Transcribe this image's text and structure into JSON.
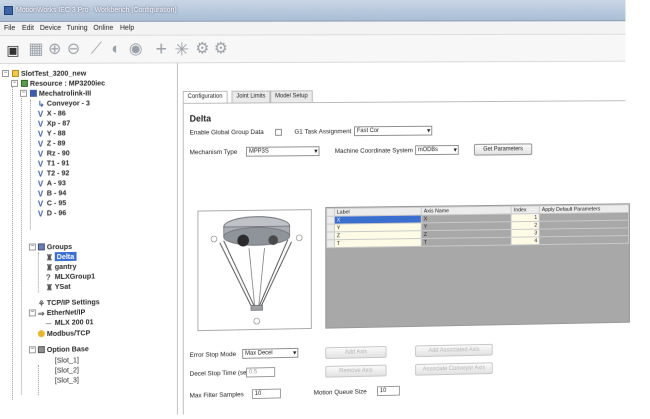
{
  "window": {
    "title": "MotionWorks IEC 3 Pro - Workbench (Configuration)"
  },
  "menu": [
    "File",
    "Edit",
    "Device",
    "Tuning",
    "Online",
    "Help"
  ],
  "toolbar": [
    "save-icon",
    "grid-icon",
    "zoom-in-icon",
    "zoom-out-icon",
    "link-icon",
    "record-icon",
    "stop-icon",
    "add-axis-icon",
    "sparkle-icon",
    "gear-icon",
    "gear-icon"
  ],
  "tree": [
    {
      "label": "SlotTest_3200_new",
      "icon": "project-icon"
    },
    {
      "label": "Resource : MP3200iec",
      "icon": "resource-icon"
    },
    {
      "label": "Mechatrolink-III",
      "icon": "network-icon"
    },
    {
      "label": "Conveyor - 3",
      "icon": "axis-icon"
    },
    {
      "label": "X - 86",
      "icon": "axis-icon"
    },
    {
      "label": "Xp - 87",
      "icon": "axis-icon"
    },
    {
      "label": "Y - 88",
      "icon": "axis-icon"
    },
    {
      "label": "Z - 89",
      "icon": "axis-icon"
    },
    {
      "label": "Rz - 90",
      "icon": "axis-icon"
    },
    {
      "label": "T1 - 91",
      "icon": "axis-icon"
    },
    {
      "label": "T2 - 92",
      "icon": "axis-icon"
    },
    {
      "label": "A - 93",
      "icon": "axis-icon"
    },
    {
      "label": "B - 94",
      "icon": "axis-icon"
    },
    {
      "label": "C - 95",
      "icon": "axis-icon"
    },
    {
      "label": "D - 96",
      "icon": "axis-icon"
    },
    {
      "label": "Groups",
      "icon": "groups-icon"
    },
    {
      "label": "Delta",
      "icon": "robot-icon",
      "selected": true
    },
    {
      "label": "gantry",
      "icon": "robot-icon"
    },
    {
      "label": "MLXGroup1",
      "icon": "robot-icon"
    },
    {
      "label": "YSat",
      "icon": "robot-icon"
    },
    {
      "label": "TCP/IP Settings",
      "icon": "network-icon"
    },
    {
      "label": "EtherNet/IP",
      "icon": "network-icon"
    },
    {
      "label": "MLX 200 01",
      "icon": "device-icon"
    },
    {
      "label": "Modbus/TCP",
      "icon": "modbus-icon"
    },
    {
      "label": "Option Base",
      "icon": "option-icon"
    },
    {
      "label": "[Slot_1]",
      "icon": "slot-icon"
    },
    {
      "label": "[Slot_2]",
      "icon": "slot-icon"
    },
    {
      "label": "[Slot_3]",
      "icon": "slot-icon"
    }
  ],
  "tabs": [
    "Configuration",
    "Joint Limits",
    "Model Setup"
  ],
  "panel": {
    "title": "Delta",
    "enable_label": "Enable Global Group Data",
    "tool_label": "G1 Task Assignment",
    "tool_value": "Fast Cor",
    "mech_label": "Mechanism Type",
    "mech_value": "MPP3S",
    "coord_label": "Machine Coordinate System",
    "coord_value": "mODBs",
    "get_btn": "Get Parameters",
    "error_stop_label": "Error Stop Mode",
    "error_stop_value": "Max Decel",
    "decel_label": "Decel Stop Time (sec)",
    "decel_value": "0.5",
    "max_filter_label": "Max Filter Samples",
    "max_filter_value": "10",
    "queue_label": "Motion Queue Size",
    "queue_value": "10",
    "btn_add": "Add Axis",
    "btn_add_assoc": "Add Associated Axis",
    "btn_remove": "Remove Axis",
    "btn_assoc_axis": "Associate Conveyor Axis"
  },
  "grid": {
    "headers": [
      "Label",
      "Axis Name",
      "Index",
      "Apply Default Parameters"
    ],
    "rows": [
      [
        "X",
        "X",
        "1",
        ""
      ],
      [
        "Y",
        "Y",
        "2",
        ""
      ],
      [
        "Z",
        "Z",
        "3",
        ""
      ],
      [
        "T",
        "T",
        "4",
        ""
      ]
    ]
  }
}
